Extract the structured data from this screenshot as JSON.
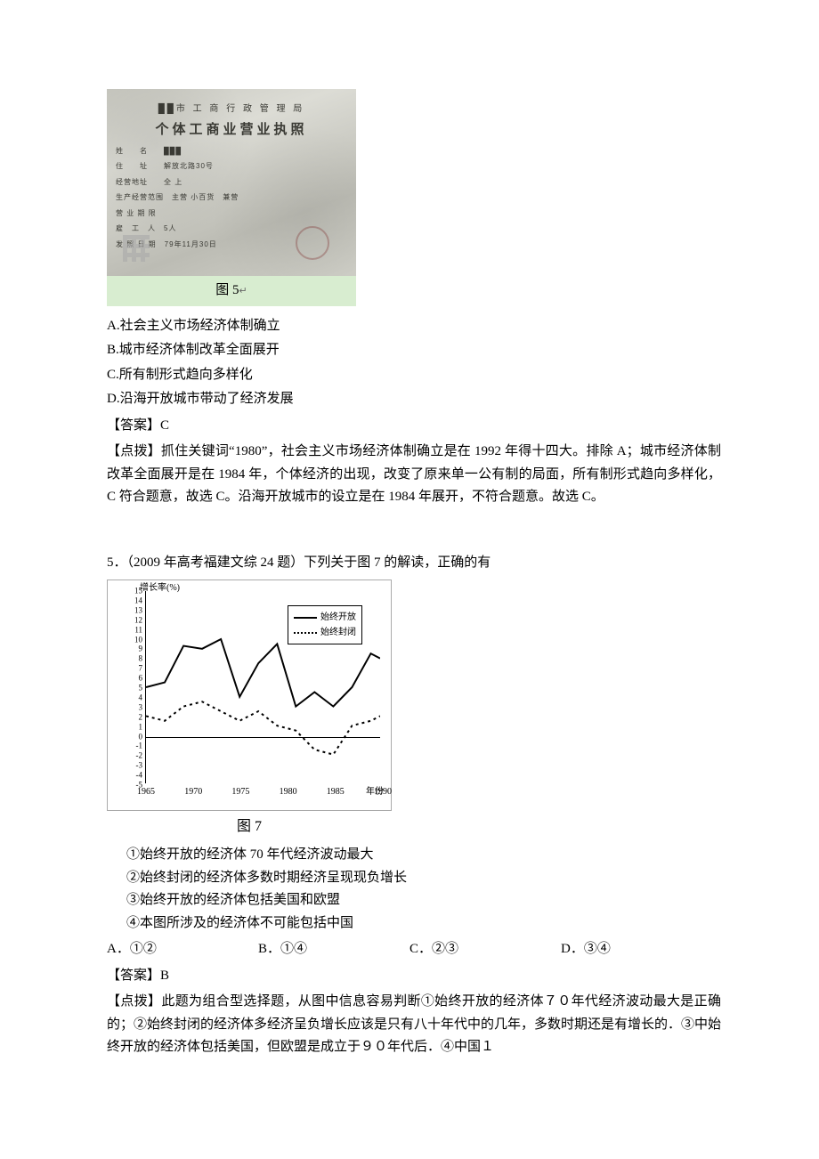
{
  "figure5": {
    "license": {
      "line1": "██市 工 商 行 政 管 理 局",
      "line2": "个体工商业营业执照",
      "rows": [
        "姓　　名　　███",
        "住　　址　　解放北路30号",
        "经营地址　　全 上",
        "生产经营范围　主营 小百货　兼营",
        "营 业 期 限",
        "雇　工　人　5人",
        "发 照 日 期　79年11月30日"
      ]
    },
    "caption": "图 5",
    "caption_ret": "↵"
  },
  "q4": {
    "options": {
      "A": "A.社会主义市场经济体制确立",
      "B": "B.城市经济体制改革全面展开",
      "C": "C.所有制形式趋向多样化",
      "D": "D.沿海开放城市带动了经济发展"
    },
    "answer": "【答案】C",
    "explain": "【点拨】抓住关键词“1980”，社会主义市场经济体制确立是在 1992 年得十四大。排除 A；城市经济体制改革全面展开是在 1984 年，个体经济的出现，改变了原来单一公有制的局面，所有制形式趋向多样化，C 符合题意，故选 C。沿海开放城市的设立是在 1984 年展开，不符合题意。故选 C。"
  },
  "q5": {
    "stem": "5．（2009 年高考福建文综 24 题）下列关于图 7 的解读，正确的有",
    "chart_caption": "图 7",
    "sub": {
      "1": "①始终开放的经济体 70 年代经济波动最大",
      "2": "②始终封闭的经济体多数时期经济呈现现负增长",
      "3": "③始终开放的经济体包括美国和欧盟",
      "4": "④本图所涉及的经济体不可能包括中国"
    },
    "choices": {
      "A": "A．①②",
      "B": "B．①④",
      "C": "C．②③",
      "D": "D．③④"
    },
    "answer": "【答案】B",
    "explain": "【点拨】此题为组合型选择题，从图中信息容易判断①始终开放的经济体７０年代经济波动最大是正确的；②始终封闭的经济体多经济呈负增长应该是只有八十年代中的几年，多数时期还是有增长的．③中始终开放的经济体包括美国，但欧盟是成立于９０年代后．④中国１"
  },
  "chart_data": {
    "type": "line",
    "title": "",
    "xlabel": "年份",
    "ylabel": "增长率(%)",
    "xlim": [
      1965,
      1990
    ],
    "ylim": [
      -5,
      15
    ],
    "x_ticks": [
      1965,
      1970,
      1975,
      1980,
      1985,
      1990
    ],
    "y_ticks": [
      -5,
      -4,
      -3,
      -2,
      -1,
      0,
      1,
      2,
      3,
      4,
      5,
      6,
      7,
      8,
      9,
      10,
      11,
      12,
      13,
      14,
      15
    ],
    "legend": [
      "始终开放",
      "始终封闭"
    ],
    "series": [
      {
        "name": "始终开放",
        "style": "solid",
        "x": [
          1965,
          1967,
          1969,
          1971,
          1973,
          1975,
          1977,
          1979,
          1981,
          1983,
          1985,
          1987,
          1989,
          1990
        ],
        "y": [
          5.0,
          5.5,
          9.3,
          9.0,
          10.0,
          4.0,
          7.5,
          9.5,
          3.0,
          4.5,
          3.0,
          5.0,
          8.5,
          8.0
        ]
      },
      {
        "name": "始终封闭",
        "style": "dotted",
        "x": [
          1965,
          1967,
          1969,
          1971,
          1973,
          1975,
          1977,
          1979,
          1981,
          1983,
          1985,
          1987,
          1989,
          1990
        ],
        "y": [
          2.0,
          1.5,
          3.0,
          3.5,
          2.5,
          1.5,
          2.5,
          1.0,
          0.5,
          -1.5,
          -2.0,
          1.0,
          1.5,
          2.0
        ]
      }
    ]
  }
}
